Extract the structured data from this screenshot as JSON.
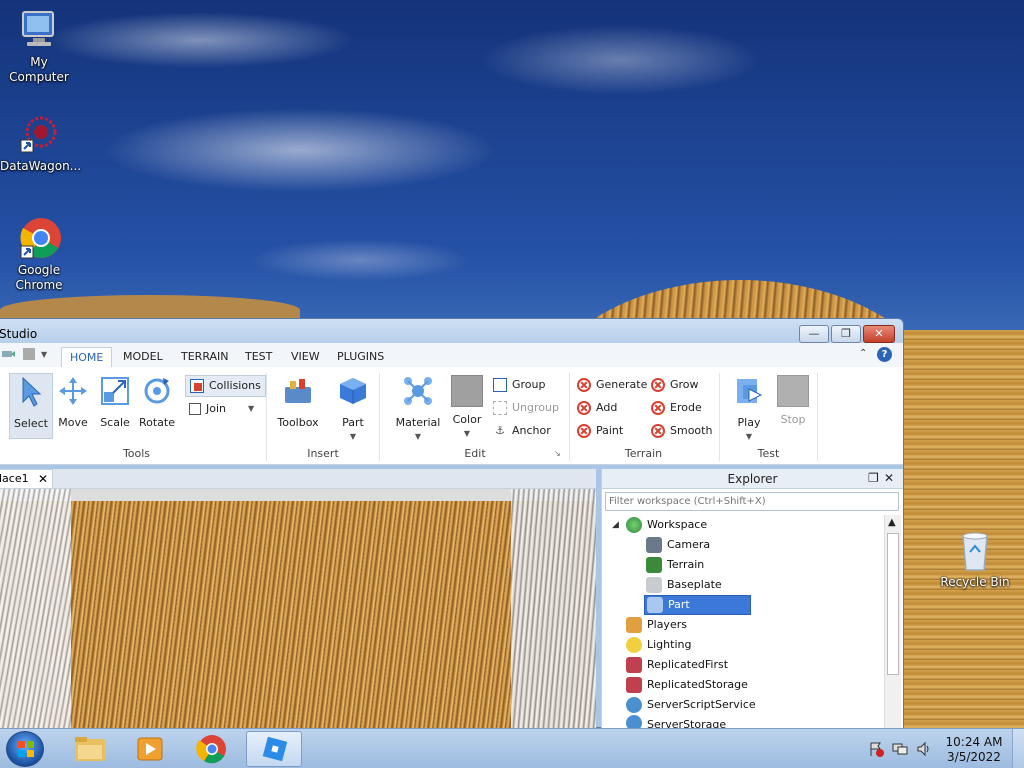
{
  "desktop": {
    "icons": [
      {
        "label": "My Computer"
      },
      {
        "label": "DataWagon..."
      },
      {
        "label": "Google Chrome"
      },
      {
        "label": "Recycle Bin"
      }
    ]
  },
  "window": {
    "title": "Studio",
    "tabs": [
      "HOME",
      "MODEL",
      "TERRAIN",
      "TEST",
      "VIEW",
      "PLUGINS"
    ],
    "active_tab": "HOME",
    "ribbon": {
      "tools": {
        "label": "Tools",
        "select": "Select",
        "move": "Move",
        "scale": "Scale",
        "rotate": "Rotate",
        "collisions": "Collisions",
        "join": "Join"
      },
      "insert": {
        "label": "Insert",
        "toolbox": "Toolbox",
        "part": "Part"
      },
      "edit": {
        "label": "Edit",
        "material": "Material",
        "color": "Color",
        "group": "Group",
        "ungroup": "Ungroup",
        "anchor": "Anchor"
      },
      "terrain": {
        "label": "Terrain",
        "generate": "Generate",
        "add": "Add",
        "paint": "Paint",
        "grow": "Grow",
        "erode": "Erode",
        "smooth": "Smooth"
      },
      "test": {
        "label": "Test",
        "play": "Play",
        "stop": "Stop"
      }
    },
    "doc_tab": "lace1",
    "explorer": {
      "title": "Explorer",
      "filter_placeholder": "Filter workspace (Ctrl+Shift+X)",
      "items": [
        {
          "label": "Workspace"
        },
        {
          "label": "Camera"
        },
        {
          "label": "Terrain"
        },
        {
          "label": "Baseplate"
        },
        {
          "label": "Part"
        },
        {
          "label": "Players"
        },
        {
          "label": "Lighting"
        },
        {
          "label": "ReplicatedFirst"
        },
        {
          "label": "ReplicatedStorage"
        },
        {
          "label": "ServerScriptService"
        },
        {
          "label": "ServerStorage"
        }
      ],
      "selected": "Part"
    }
  },
  "taskbar": {
    "time": "10:24 AM",
    "date": "3/5/2022"
  }
}
